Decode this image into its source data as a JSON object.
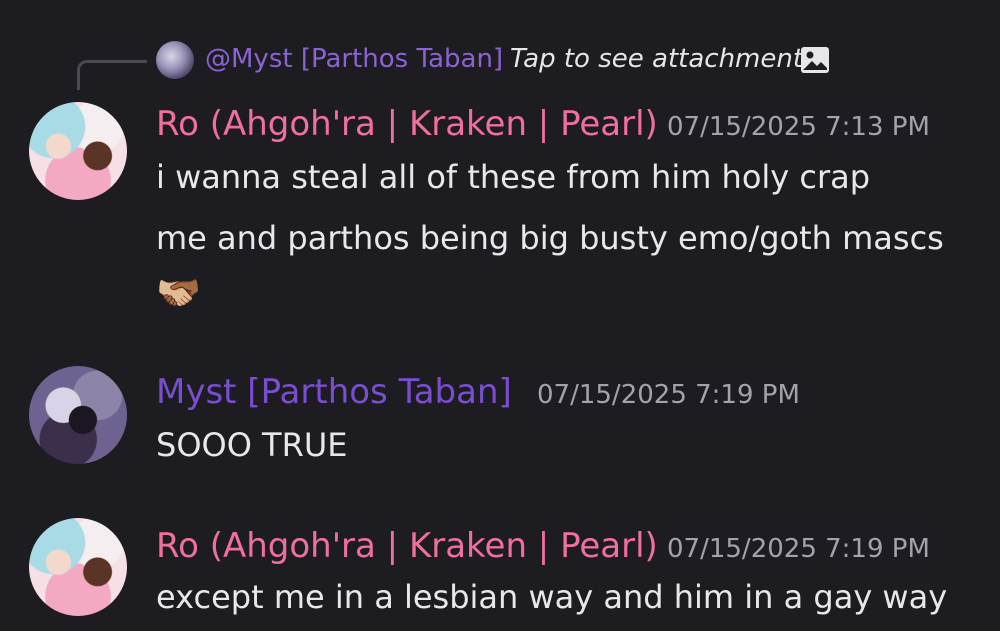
{
  "reply": {
    "name": "@Myst [Parthos Taban]",
    "text": "Tap to see attachment",
    "icon": "image-icon"
  },
  "messages": [
    {
      "author": "Ro (Ahgoh'ra | Kraken | Pearl)",
      "timestamp": "07/15/2025 7:13 PM",
      "lines": [
        "i wanna steal all of these from him holy crap",
        "me and parthos being big busty emo/goth mascs"
      ],
      "emoji": "🫱🏼‍🫲🏾"
    },
    {
      "author": "Myst [Parthos Taban]",
      "timestamp": "07/15/2025 7:19 PM",
      "lines": [
        "SOOO TRUE"
      ]
    },
    {
      "author": "Ro (Ahgoh'ra | Kraken | Pearl)",
      "timestamp": "07/15/2025 7:19 PM",
      "lines": [
        "except me in a lesbian way and him in a gay way"
      ]
    }
  ],
  "colors": {
    "background": "#1c1c21",
    "ro_name": "#ef6f9f",
    "myst_name": "#7a4ed0",
    "timestamp": "#a3a4ab",
    "text": "#e8e8ec"
  }
}
